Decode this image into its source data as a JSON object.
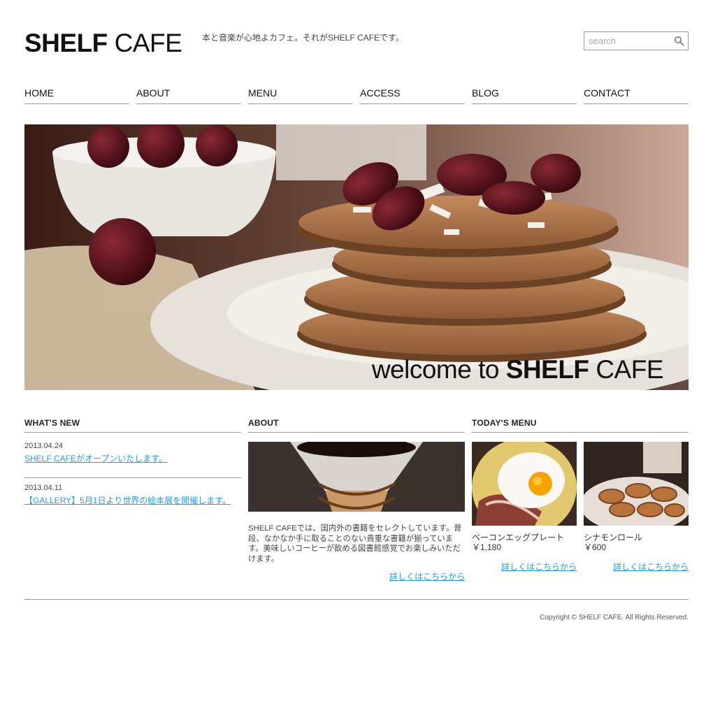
{
  "header": {
    "logo_bold": "SHELF",
    "logo_light": "CAFE",
    "tagline": "本と音楽が心地よカフェ。それがSHELF CAFEです。",
    "search_placeholder": "search"
  },
  "nav": {
    "items": [
      {
        "label": "HOME"
      },
      {
        "label": "ABOUT"
      },
      {
        "label": "MENU"
      },
      {
        "label": "ACCESS"
      },
      {
        "label": "BLOG"
      },
      {
        "label": "CONTACT"
      }
    ]
  },
  "hero": {
    "caption_pre": "welcome to",
    "caption_bold": "SHELF",
    "caption_light": "CAFE"
  },
  "whats_new": {
    "title": "WHAT'S NEW",
    "items": [
      {
        "date": "2013.04.24",
        "text": "SHELF CAFEがオープンいたします。"
      },
      {
        "date": "2013.04.11",
        "text": "【GALLERY】5月1日より世界の絵本展を開催します。"
      }
    ]
  },
  "about": {
    "title": "ABOUT",
    "text": "SHELF CAFEでは、国内外の書籍をセレクトしています。普段、なかなか手に取ることのない貴重な書籍が揃っています。美味しいコーヒーが飲める図書館感覚でお楽しみいただけます。",
    "more": "詳しくはこちらから"
  },
  "todays_menu": {
    "title": "TODAY'S MENU",
    "items": [
      {
        "name": "ベーコンエッグプレート",
        "price": "￥1,180",
        "more": "詳しくはこちらから"
      },
      {
        "name": "シナモンロール",
        "price": "￥600",
        "more": "詳しくはこちらから"
      }
    ]
  },
  "footer": {
    "copyright": "Copyright © SHELF CAFE. All Rights Reserved."
  },
  "colors": {
    "link": "#2a9bd6",
    "rule": "#999999",
    "text": "#333333"
  }
}
